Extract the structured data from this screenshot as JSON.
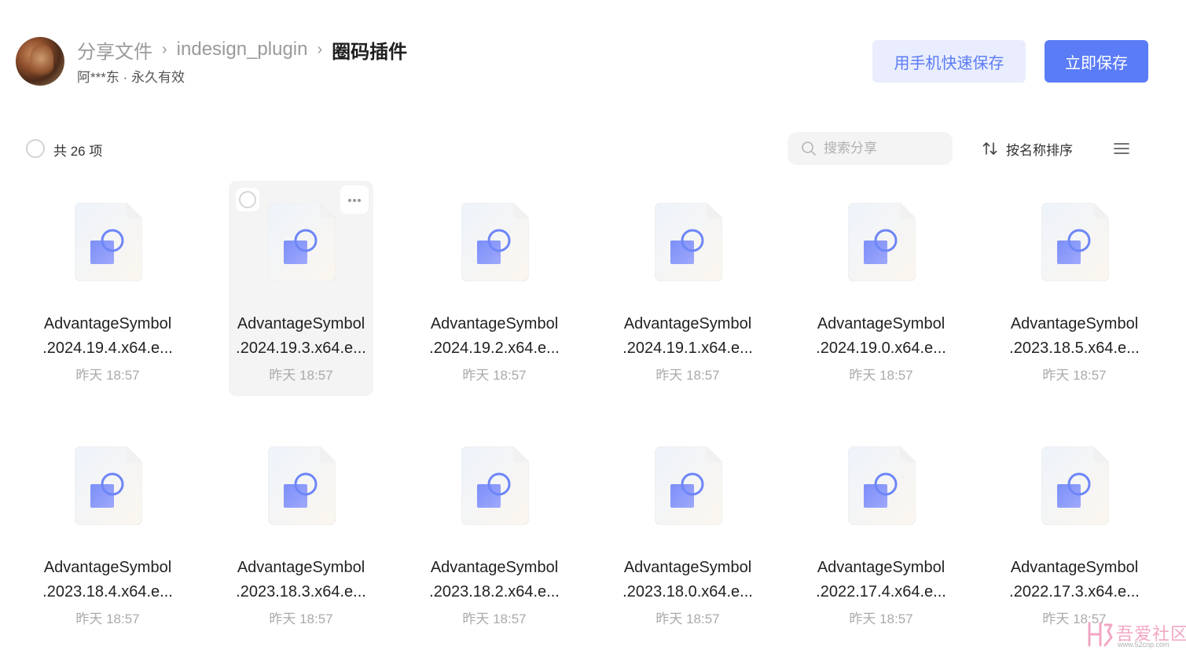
{
  "breadcrumb": {
    "items": [
      "分享文件",
      "indesign_plugin"
    ],
    "separator": "›",
    "current": "圈码插件"
  },
  "owner": {
    "text": "阿***东 · 永久有效"
  },
  "actions": {
    "phone_save": "用手机快速保存",
    "save_now": "立即保存"
  },
  "toolbar": {
    "count": "共 26 项",
    "search_placeholder": "搜索分享",
    "sort_label": "按名称排序"
  },
  "files": [
    {
      "line1": "AdvantageSymbol",
      "line2": ".2024.19.4.x64.e...",
      "time": "昨天 18:57"
    },
    {
      "line1": "AdvantageSymbol",
      "line2": ".2024.19.3.x64.e...",
      "time": "昨天 18:57"
    },
    {
      "line1": "AdvantageSymbol",
      "line2": ".2024.19.2.x64.e...",
      "time": "昨天 18:57"
    },
    {
      "line1": "AdvantageSymbol",
      "line2": ".2024.19.1.x64.e...",
      "time": "昨天 18:57"
    },
    {
      "line1": "AdvantageSymbol",
      "line2": ".2024.19.0.x64.e...",
      "time": "昨天 18:57"
    },
    {
      "line1": "AdvantageSymbol",
      "line2": ".2023.18.5.x64.e...",
      "time": "昨天 18:57"
    },
    {
      "line1": "AdvantageSymbol",
      "line2": ".2023.18.4.x64.e...",
      "time": "昨天 18:57"
    },
    {
      "line1": "AdvantageSymbol",
      "line2": ".2023.18.3.x64.e...",
      "time": "昨天 18:57"
    },
    {
      "line1": "AdvantageSymbol",
      "line2": ".2023.18.2.x64.e...",
      "time": "昨天 18:57"
    },
    {
      "line1": "AdvantageSymbol",
      "line2": ".2023.18.0.x64.e...",
      "time": "昨天 18:57"
    },
    {
      "line1": "AdvantageSymbol",
      "line2": ".2022.17.4.x64.e...",
      "time": "昨天 18:57"
    },
    {
      "line1": "AdvantageSymbol",
      "line2": ".2022.17.3.x64.e...",
      "time": "昨天 18:57"
    }
  ],
  "hovered_index": 1,
  "icons": {
    "file": "app-file-icon",
    "search": "search-icon",
    "sort": "sort-arrows-icon",
    "view": "list-view-icon",
    "more": "more-dots-icon"
  },
  "colors": {
    "accent": "#5b7cf7",
    "accent_light": "#e9edfd",
    "muted": "#9a9a9a",
    "hover_bg": "#f4f4f5"
  },
  "watermark": {
    "text": "吾爱社区",
    "sub": "www.52cnp.com"
  }
}
